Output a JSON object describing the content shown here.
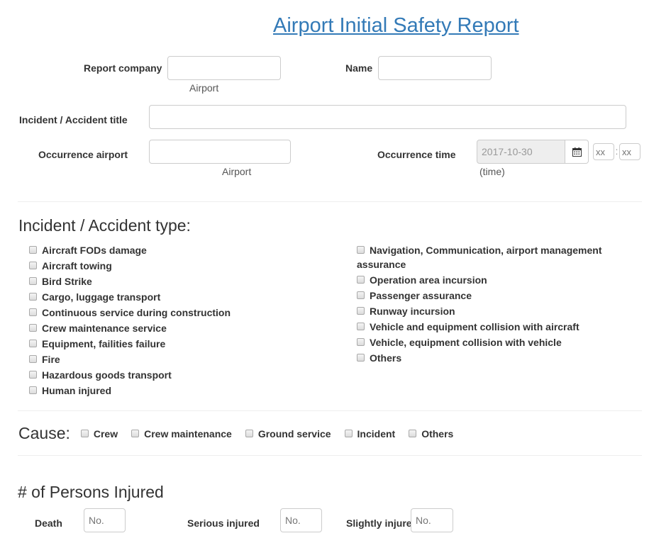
{
  "page": {
    "title": "Airport Initial Safety Report"
  },
  "form": {
    "report_company": {
      "label": "Report company",
      "value": "",
      "help": "Airport"
    },
    "name": {
      "label": "Name",
      "value": ""
    },
    "incident_title": {
      "label": "Incident / Accident title",
      "value": ""
    },
    "occurrence_airport": {
      "label": "Occurrence airport",
      "value": "",
      "help": "Airport"
    },
    "occurrence_time": {
      "label": "Occurrence time",
      "date_value": "2017-10-30",
      "calendar_icon": "calendar-icon",
      "hour_placeholder": "xx",
      "separator": ":",
      "minute_placeholder": "xx",
      "help": "(time)"
    }
  },
  "incident_type": {
    "heading": "Incident / Accident type:",
    "left_options": [
      {
        "label": "Aircraft FODs damage",
        "checked": false
      },
      {
        "label": "Aircraft towing",
        "checked": false
      },
      {
        "label": "Bird Strike",
        "checked": false
      },
      {
        "label": "Cargo, luggage transport",
        "checked": false
      },
      {
        "label": "Continuous service during construction",
        "checked": false
      },
      {
        "label": "Crew maintenance service",
        "checked": false
      },
      {
        "label": "Equipment, failities failure",
        "checked": false
      },
      {
        "label": "Fire",
        "checked": false
      },
      {
        "label": "Hazardous goods transport",
        "checked": false
      },
      {
        "label": "Human injured",
        "checked": false
      }
    ],
    "right_options": [
      {
        "label": "Navigation, Communication, airport management assurance",
        "checked": false
      },
      {
        "label": "Operation area incursion",
        "checked": false
      },
      {
        "label": "Passenger assurance",
        "checked": false
      },
      {
        "label": "Runway incursion",
        "checked": false
      },
      {
        "label": "Vehicle and equipment collision with aircraft",
        "checked": false
      },
      {
        "label": "Vehicle, equipment collision with vehicle",
        "checked": false
      },
      {
        "label": "Others",
        "checked": false
      }
    ]
  },
  "cause": {
    "heading": "Cause:",
    "options": [
      {
        "label": "Crew",
        "checked": false
      },
      {
        "label": "Crew maintenance",
        "checked": false
      },
      {
        "label": "Ground service",
        "checked": false
      },
      {
        "label": "Incident",
        "checked": false
      },
      {
        "label": "Others",
        "checked": false
      }
    ]
  },
  "injured": {
    "heading": "# of Persons Injured",
    "death": {
      "label": "Death",
      "placeholder": "No."
    },
    "serious": {
      "label": "Serious injured",
      "placeholder": "No."
    },
    "slight": {
      "label": "Slightly injure",
      "placeholder": "No."
    }
  }
}
